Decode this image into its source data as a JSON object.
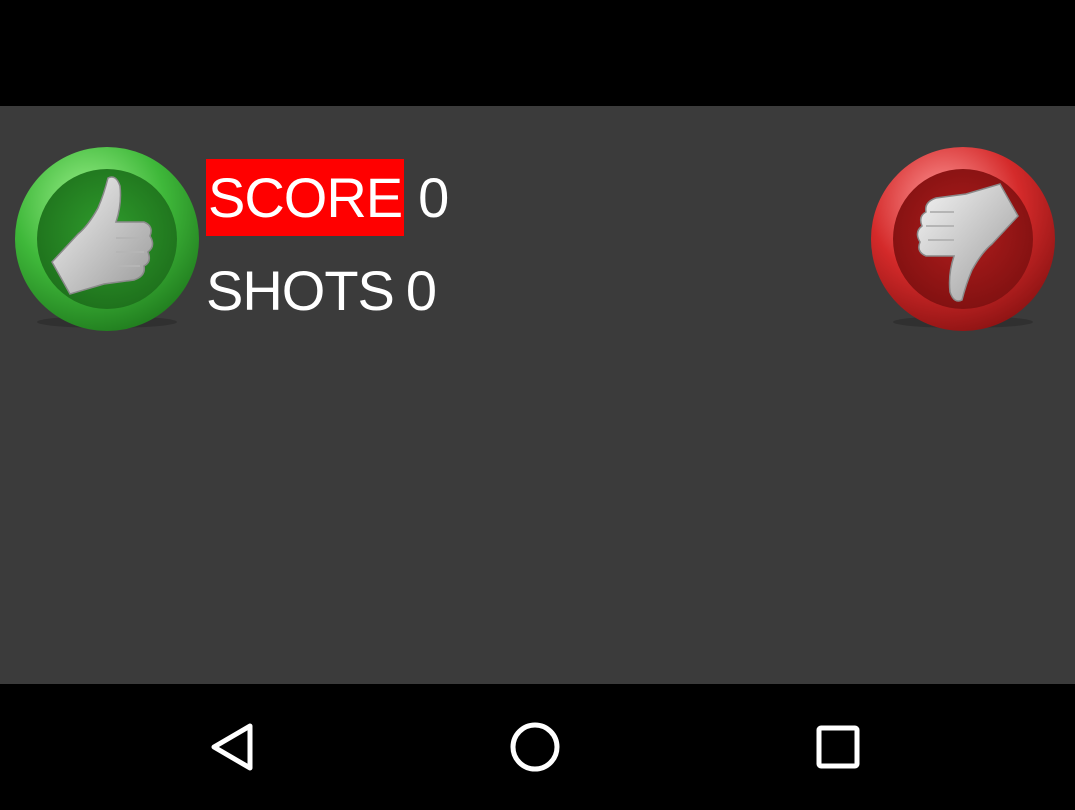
{
  "scoreboard": {
    "score_label": "SCORE",
    "score_value": "0",
    "shots_label": "SHOTS",
    "shots_value": "0"
  },
  "buttons": {
    "thumbs_up_icon": "thumbs-up-icon",
    "thumbs_down_icon": "thumbs-down-icon"
  },
  "navigation": {
    "back_icon": "back-triangle-icon",
    "home_icon": "home-circle-icon",
    "recents_icon": "recents-square-icon"
  },
  "colors": {
    "app_background": "#3b3b3b",
    "bars": "#000000",
    "score_highlight": "#ff0000",
    "thumbs_up_green": "#3fb83a",
    "thumbs_down_red": "#d42a2a",
    "text": "#ffffff"
  }
}
